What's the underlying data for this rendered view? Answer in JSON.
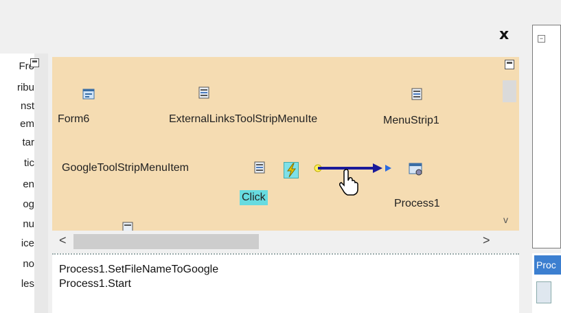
{
  "window": {
    "close_glyph": "x",
    "minus_glyph": "−"
  },
  "left_panel": {
    "items": [
      "Fro",
      "ribu",
      "nst",
      "em",
      "tar",
      "tic",
      "en",
      "og",
      "nu",
      "ice",
      "no",
      "les"
    ]
  },
  "designer": {
    "components": [
      {
        "label": "Form6",
        "icon": "form-icon"
      },
      {
        "label": "ExternalLinksToolStripMenuIte",
        "icon": "menu-item-icon"
      },
      {
        "label": "MenuStrip1",
        "icon": "menu-strip-icon"
      },
      {
        "label": "GoogleToolStripMenuItem",
        "icon": "menu-item-icon"
      },
      {
        "label": "Process1",
        "icon": "process-icon"
      }
    ],
    "event_label": "Click",
    "event_icon": "lightning-icon",
    "cursor": "hand-pointer-icon"
  },
  "scroll": {
    "left_glyph": "<",
    "right_glyph": ">",
    "down_glyph": "v"
  },
  "code": {
    "lines": [
      "Process1.SetFileNameToGoogle",
      "Process1.Start"
    ]
  },
  "props": {
    "header": "Proc"
  },
  "colors": {
    "designer_bg": "#f5dcb2",
    "event_highlight": "#67dbe0",
    "arrow": "#1a1a9a",
    "props_header": "#3c7fd0"
  }
}
